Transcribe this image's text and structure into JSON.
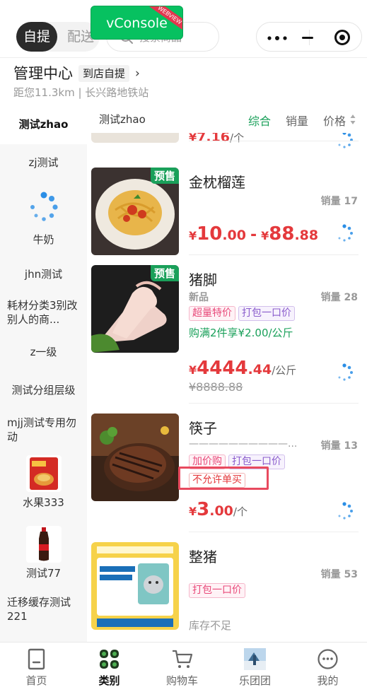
{
  "topbar": {
    "mode_active": "自提",
    "mode_inactive": "配送",
    "search_placeholder": "搜索商品",
    "vconsole_label": "vConsole",
    "vconsole_ribbon": "WEBVIEW"
  },
  "store": {
    "title": "管理中心",
    "mode_tag": "到店自提",
    "arrow": "›",
    "subtitle": "距您11.3km | 长兴路地铁站"
  },
  "sidebar": {
    "items": [
      {
        "label": "测试zhao"
      },
      {
        "label": "zj测试"
      },
      {
        "label": "牛奶"
      },
      {
        "label": "jhn测试"
      },
      {
        "label": "耗材分类3别改别人的商..."
      },
      {
        "label": "z一级"
      },
      {
        "label": "测试分组层级"
      },
      {
        "label": "mjj测试专用勿动"
      },
      {
        "label": "水果333"
      },
      {
        "label": "测试77"
      },
      {
        "label": "迁移缓存测试221"
      }
    ]
  },
  "sortbar": {
    "category": "测试zhao",
    "options": [
      "综合",
      "销量",
      "价格"
    ]
  },
  "products": [
    {
      "partial_price_cur": "¥",
      "partial_price": "7.16",
      "partial_unit": "/个"
    },
    {
      "name": "金枕榴莲",
      "badge": "预售",
      "sold": "销量 17",
      "price_cur": "¥",
      "price_int": "10",
      "price_dec": ".00",
      "price_dash": "-",
      "price2_cur": "¥",
      "price2_int": "88",
      "price2_dec": ".88"
    },
    {
      "name": "猪脚",
      "badge": "预售",
      "sub": "新品",
      "sold": "销量 28",
      "tags": [
        "超量特价",
        "打包一口价"
      ],
      "promo": "购满2件享¥2.00/公斤",
      "price_cur": "¥",
      "price_int": "4444",
      "price_dec": ".44",
      "unit": "/公斤",
      "orig": "¥8888.88"
    },
    {
      "name": "筷子",
      "sub": "——————————...",
      "sold": "销量 13",
      "tags": [
        "加价购",
        "打包一口价"
      ],
      "tag2": "不允许单买",
      "price_cur": "¥",
      "price_int": "3",
      "price_dec": ".00",
      "unit": "/个"
    },
    {
      "name": "整猪",
      "sold": "销量 53",
      "tags": [
        "打包一口价"
      ],
      "stock": "库存不足"
    }
  ],
  "tabbar": {
    "tabs": [
      {
        "label": "首页",
        "icon": "home-icon"
      },
      {
        "label": "类别",
        "icon": "category-icon"
      },
      {
        "label": "购物车",
        "icon": "cart-icon"
      },
      {
        "label": "乐团团",
        "icon": "avatar-icon"
      },
      {
        "label": "我的",
        "icon": "profile-icon"
      }
    ],
    "active_index": 1
  },
  "colors": {
    "accent_green": "#1aa05a",
    "price_red": "#e4393c",
    "spinner_blue": "#2a8ee6",
    "highlight_red": "#e84a5f"
  }
}
